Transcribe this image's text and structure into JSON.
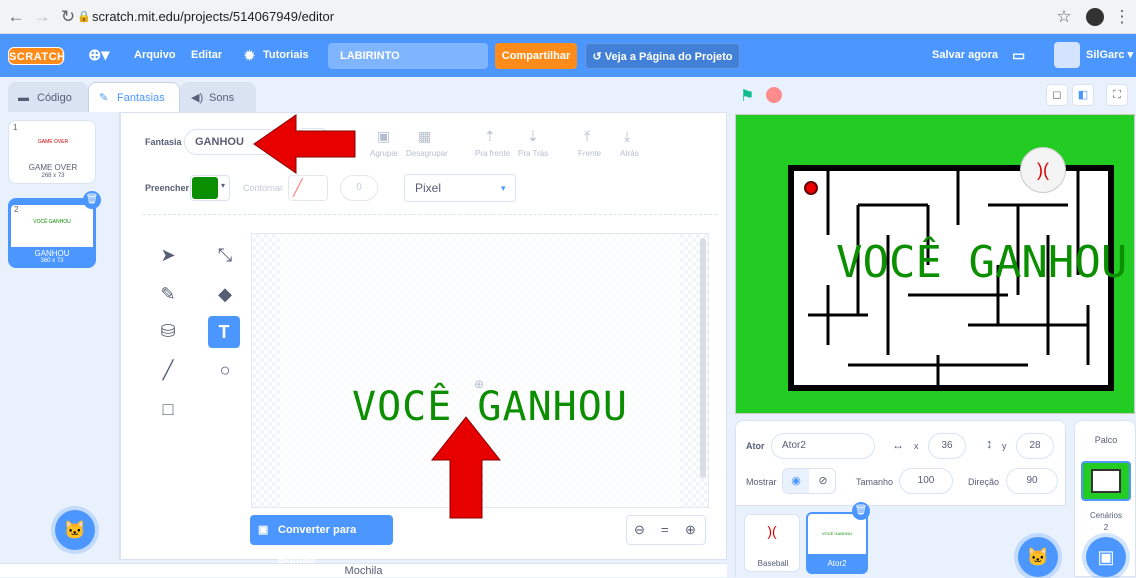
{
  "browser": {
    "url": "scratch.mit.edu/projects/514067949/editor"
  },
  "menu": {
    "logo": "SCRATCH",
    "arquivo": "Arquivo",
    "editar": "Editar",
    "tutoriais": "Tutoriais",
    "project_title": "LABIRINTO",
    "share": "Compartilhar",
    "see_project": "Veja a Página do Projeto",
    "save_now": "Salvar agora",
    "user": "SilGarc"
  },
  "tabs": {
    "code": "Código",
    "costumes": "Fantasias",
    "sounds": "Sons"
  },
  "costumes": [
    {
      "num": "1",
      "name": "GAME OVER",
      "size": "268 x 73",
      "thumb": "GAME OVER"
    },
    {
      "num": "2",
      "name": "GANHOU",
      "size": "360 x 73",
      "thumb": "VOCÊ GANHOU"
    }
  ],
  "editor": {
    "costume_label": "Fantasia",
    "costume_name": "GANHOU",
    "group": "Agrupar",
    "ungroup": "Desagrupar",
    "forward": "Pra frente",
    "backward": "Pra Trás",
    "front": "Frente",
    "back": "Atrás",
    "fill_label": "Preencher",
    "outline_label": "Contornar",
    "outline_value": "0",
    "font": "Pixel",
    "canvas_text": "VOCÊ GANHOU",
    "convert": "Converter para Bitmap",
    "fill_color": "#0b8f00"
  },
  "stage": {
    "text": "VOCÊ GANHOU",
    "bg_color": "#22cc22"
  },
  "sprite": {
    "ator_label": "Ator",
    "ator_name": "Ator2",
    "x_label": "x",
    "x": "36",
    "y_label": "y",
    "y": "28",
    "show_label": "Mostrar",
    "size_label": "Tamanho",
    "size": "100",
    "direction_label": "Direção",
    "direction": "90",
    "sprites": [
      {
        "name": "Baseball"
      },
      {
        "name": "Ator2"
      }
    ]
  },
  "stagepanel": {
    "title": "Palco",
    "backdrops_label": "Cenários",
    "backdrops_count": "2"
  },
  "backpack": "Mochila",
  "colors": {
    "scratch_blue": "#4c97ff",
    "orange": "#ff8c1a",
    "arrow_red": "#e60000"
  }
}
